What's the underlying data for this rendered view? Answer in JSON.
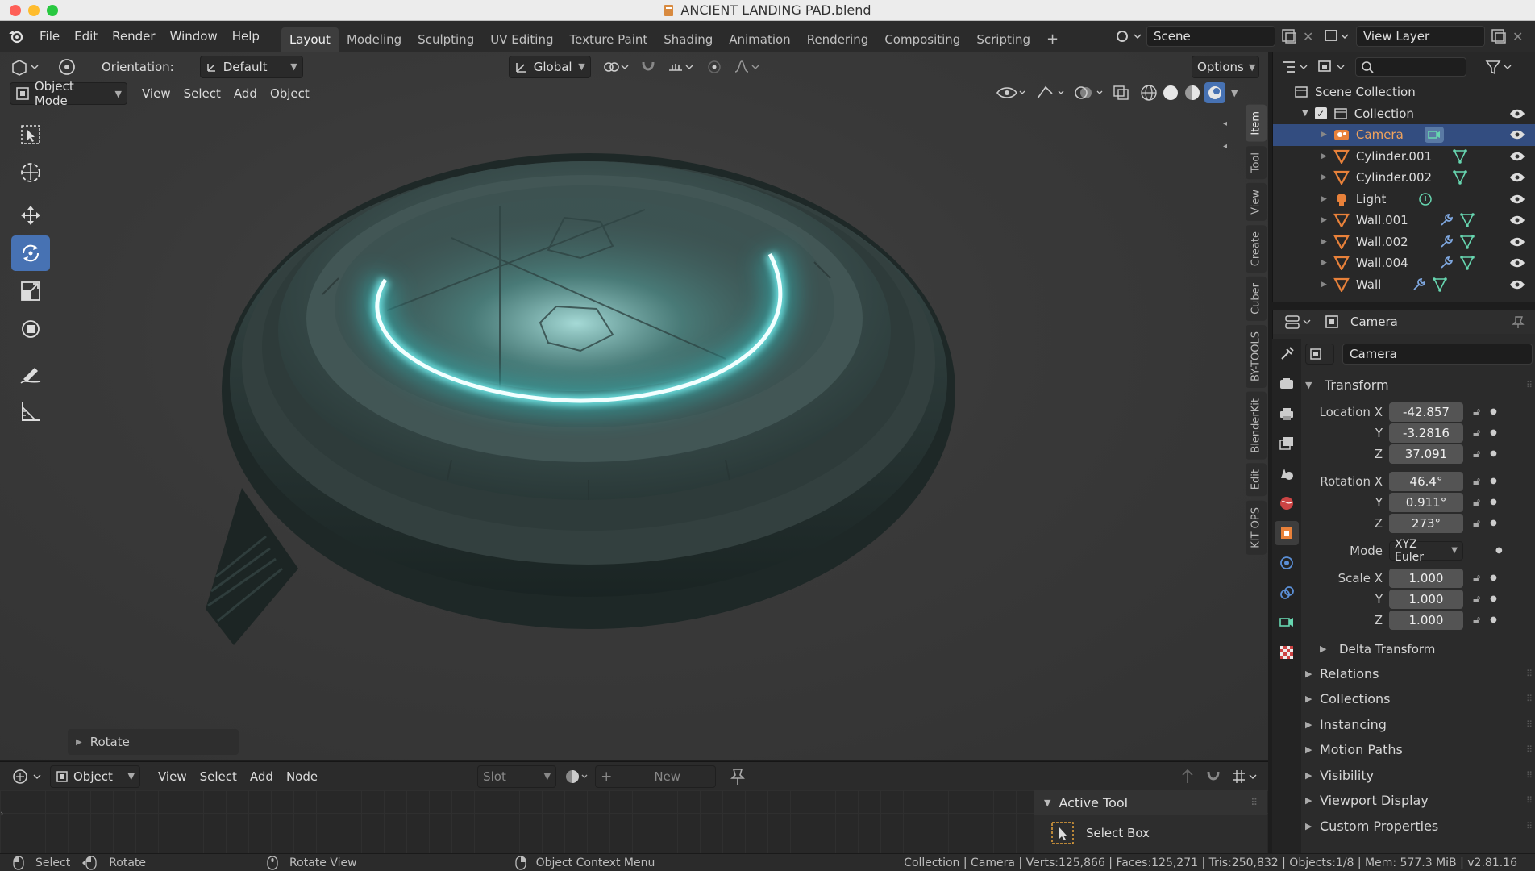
{
  "window": {
    "title": "ANCIENT LANDING PAD.blend"
  },
  "menu": [
    "File",
    "Edit",
    "Render",
    "Window",
    "Help"
  ],
  "workspaces": [
    "Layout",
    "Modeling",
    "Sculpting",
    "UV Editing",
    "Texture Paint",
    "Shading",
    "Animation",
    "Rendering",
    "Compositing",
    "Scripting"
  ],
  "active_workspace": "Layout",
  "scene": {
    "name": "Scene",
    "view_layer": "View Layer"
  },
  "viewport": {
    "orientation_label": "Orientation:",
    "orientation_value": "Default",
    "transform_space": "Global",
    "options_label": "Options",
    "mode": "Object Mode",
    "menus": [
      "View",
      "Select",
      "Add",
      "Object"
    ],
    "side_tabs": [
      "Item",
      "Tool",
      "View",
      "Create",
      "Cuber",
      "BY-TOOLS",
      "BlenderKit",
      "Edit",
      "KIT OPS"
    ],
    "operator_panel": "Rotate"
  },
  "shader_editor": {
    "type": "Object",
    "menus": [
      "View",
      "Select",
      "Add",
      "Node"
    ],
    "slot_placeholder": "Slot",
    "new_label": "New",
    "active_tool_title": "Active Tool",
    "active_tool_name": "Select Box"
  },
  "outliner": {
    "root": "Scene Collection",
    "collection": "Collection",
    "items": [
      {
        "name": "Camera",
        "type": "camera",
        "selected": true
      },
      {
        "name": "Cylinder.001",
        "type": "mesh"
      },
      {
        "name": "Cylinder.002",
        "type": "mesh"
      },
      {
        "name": "Light",
        "type": "light"
      },
      {
        "name": "Wall.001",
        "type": "mesh",
        "modifier": true
      },
      {
        "name": "Wall.002",
        "type": "mesh",
        "modifier": true
      },
      {
        "name": "Wall.004",
        "type": "mesh",
        "modifier": true
      },
      {
        "name": "Wall",
        "type": "mesh",
        "modifier": true
      }
    ]
  },
  "properties": {
    "context": "Camera",
    "object_name": "Camera",
    "transform_title": "Transform",
    "location": {
      "label": "Location X",
      "x": "-42.857",
      "y": "-3.2816",
      "z": "37.091"
    },
    "rotation": {
      "label": "Rotation X",
      "x": "46.4°",
      "y": "0.911°",
      "z": "273°"
    },
    "mode_label": "Mode",
    "mode_value": "XYZ Euler",
    "scale": {
      "label": "Scale X",
      "x": "1.000",
      "y": "1.000",
      "z": "1.000"
    },
    "axis_y": "Y",
    "axis_z": "Z",
    "delta": "Delta Transform",
    "panels": [
      "Relations",
      "Collections",
      "Instancing",
      "Motion Paths",
      "Visibility",
      "Viewport Display",
      "Custom Properties"
    ]
  },
  "status": {
    "select": "Select",
    "rotate": "Rotate",
    "rotate_view": "Rotate View",
    "context_menu": "Object Context Menu",
    "stats": "Collection | Camera | Verts:125,866 | Faces:125,271 | Tris:250,832 | Objects:1/8 | Mem: 577.3 MiB | v2.81.16"
  },
  "colors": {
    "accent": "#4772b3",
    "selection": "#334d80",
    "glow": "#5ff4f4",
    "object_orange": "#e8813a",
    "camera_highlight": "#f0a35c"
  }
}
